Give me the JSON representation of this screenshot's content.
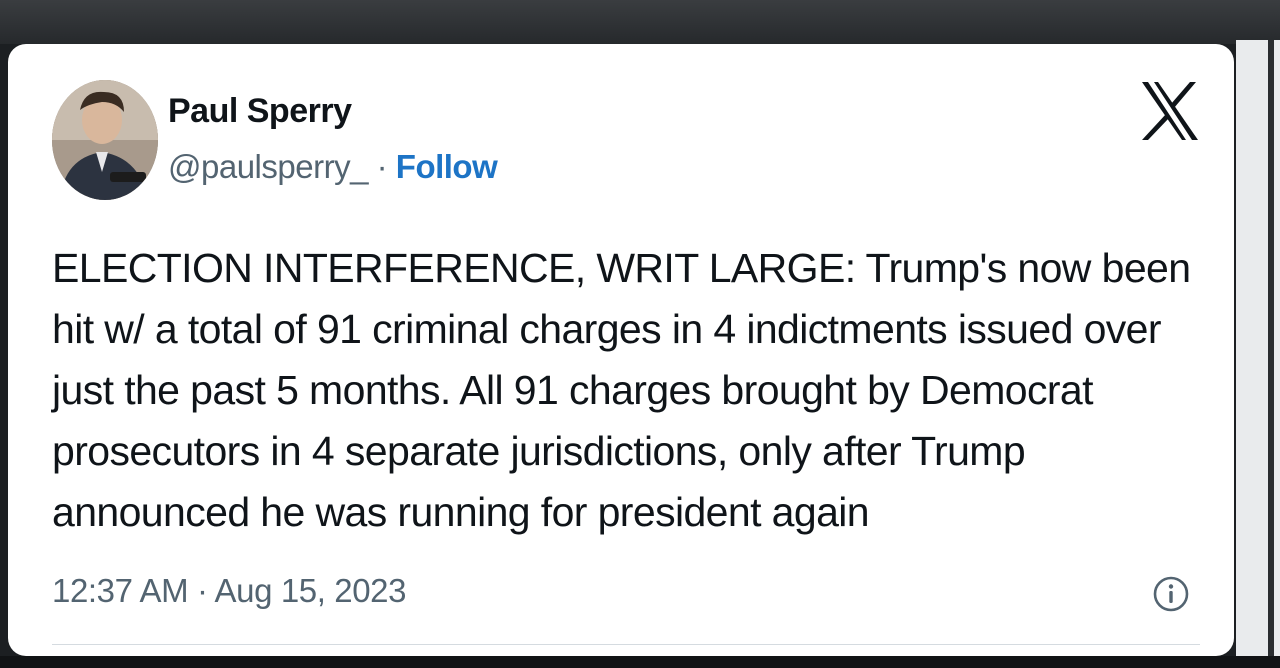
{
  "tweet": {
    "author_name": "Paul Sperry",
    "handle": "@paulsperry_",
    "separator": "·",
    "follow_label": "Follow",
    "text": "ELECTION INTERFERENCE, WRIT LARGE: Trump's now been hit w/ a total of 91 criminal charges in 4 indictments issued over just the past 5 months. All 91 charges brought by Democrat prosecutors in 4 separate jurisdictions, only after Trump announced he was running for president again",
    "timestamp": "12:37 AM · Aug 15, 2023"
  },
  "icons": {
    "platform_logo": "x-logo-icon",
    "info": "info-icon"
  },
  "colors": {
    "text": "#0f1419",
    "secondary_text": "#536471",
    "follow_link": "#1d74c6",
    "card_background": "#ffffff"
  }
}
